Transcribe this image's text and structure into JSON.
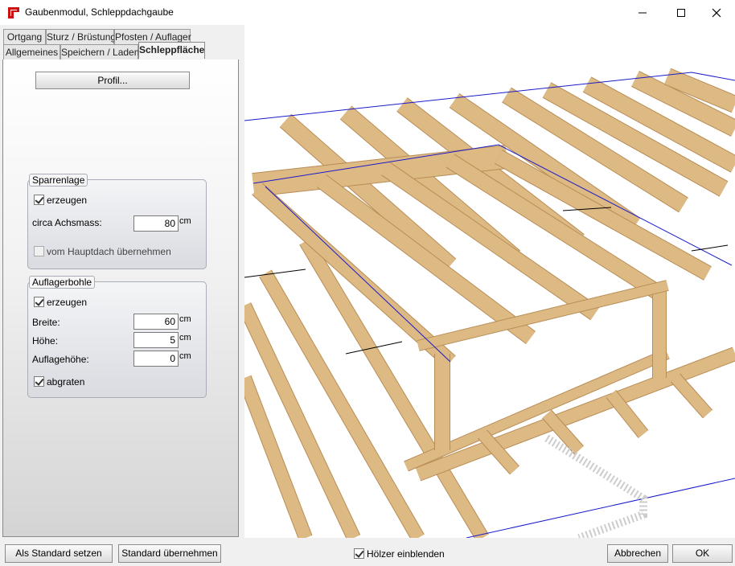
{
  "window": {
    "title": "Gaubenmodul, Schleppdachgaube",
    "controls": [
      "minimize",
      "maximize",
      "close"
    ]
  },
  "tabs": {
    "row1": [
      "Ortgang",
      "Sturz / Brüstung",
      "Pfosten / Auflager"
    ],
    "row2": [
      "Allgemeines",
      "Speichern / Laden",
      "Schleppfläche"
    ],
    "active": "Schleppfläche"
  },
  "profil_button": "Profil...",
  "sparrenlage": {
    "title": "Sparrenlage",
    "erzeugen_label": "erzeugen",
    "erzeugen_checked": true,
    "achsmass_label": "circa Achsmass:",
    "achsmass_value": "80",
    "achsmass_unit": "cm",
    "hauptdach_label": "vom Hauptdach übernehmen",
    "hauptdach_checked": false
  },
  "auflagerbohle": {
    "title": "Auflagerbohle",
    "erzeugen_label": "erzeugen",
    "erzeugen_checked": true,
    "breite_label": "Breite:",
    "breite_value": "60",
    "breite_unit": "cm",
    "hoehe_label": "Höhe:",
    "hoehe_value": "5",
    "hoehe_unit": "cm",
    "auflagehoehe_label": "Auflagehöhe:",
    "auflagehoehe_value": "0",
    "auflagehoehe_unit": "cm",
    "abgraten_label": "abgraten",
    "abgraten_checked": true
  },
  "bottom": {
    "als_standard": "Als Standard setzen",
    "standard_uebernehmen": "Standard übernehmen",
    "hoelzer_label": "Hölzer einblenden",
    "hoelzer_checked": true,
    "abbrechen": "Abbrechen",
    "ok": "OK"
  },
  "colors": {
    "wood": "#ddb984",
    "wood_dark": "#b88d55",
    "outline": "#1a1acc",
    "app_icon": "#cc1010"
  }
}
